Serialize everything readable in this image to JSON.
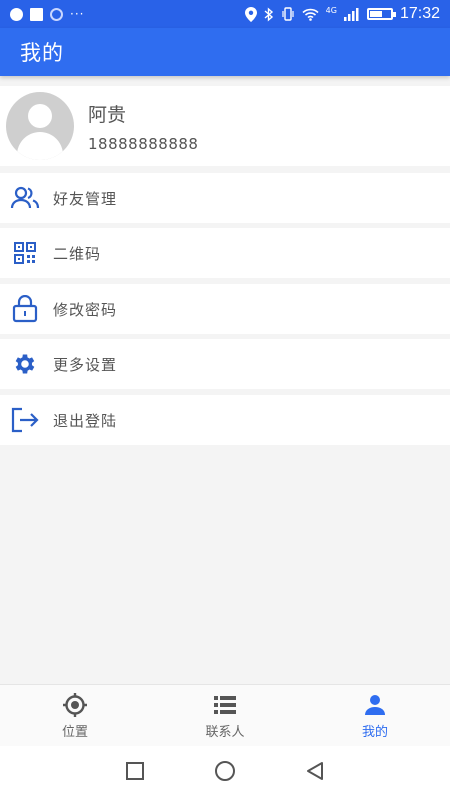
{
  "status_bar": {
    "dots": "···",
    "network": "4G",
    "time": "17:32"
  },
  "app_bar": {
    "title": "我的"
  },
  "profile": {
    "name": "阿贵",
    "phone": "18888888888"
  },
  "menu": [
    {
      "label": "好友管理",
      "icon": "friends-icon"
    },
    {
      "label": "二维码",
      "icon": "qr-code-icon"
    },
    {
      "label": "修改密码",
      "icon": "lock-icon"
    },
    {
      "label": "更多设置",
      "icon": "gear-icon"
    },
    {
      "label": "退出登陆",
      "icon": "logout-icon"
    }
  ],
  "bottom_nav": [
    {
      "label": "位置",
      "icon": "location-target-icon",
      "active": false
    },
    {
      "label": "联系人",
      "icon": "list-icon",
      "active": false
    },
    {
      "label": "我的",
      "icon": "person-icon",
      "active": true
    }
  ],
  "colors": {
    "primary": "#2f6df0",
    "status_bar": "#2962e8",
    "icon_blue": "#2b5fc7",
    "background": "#f4f4f4"
  }
}
